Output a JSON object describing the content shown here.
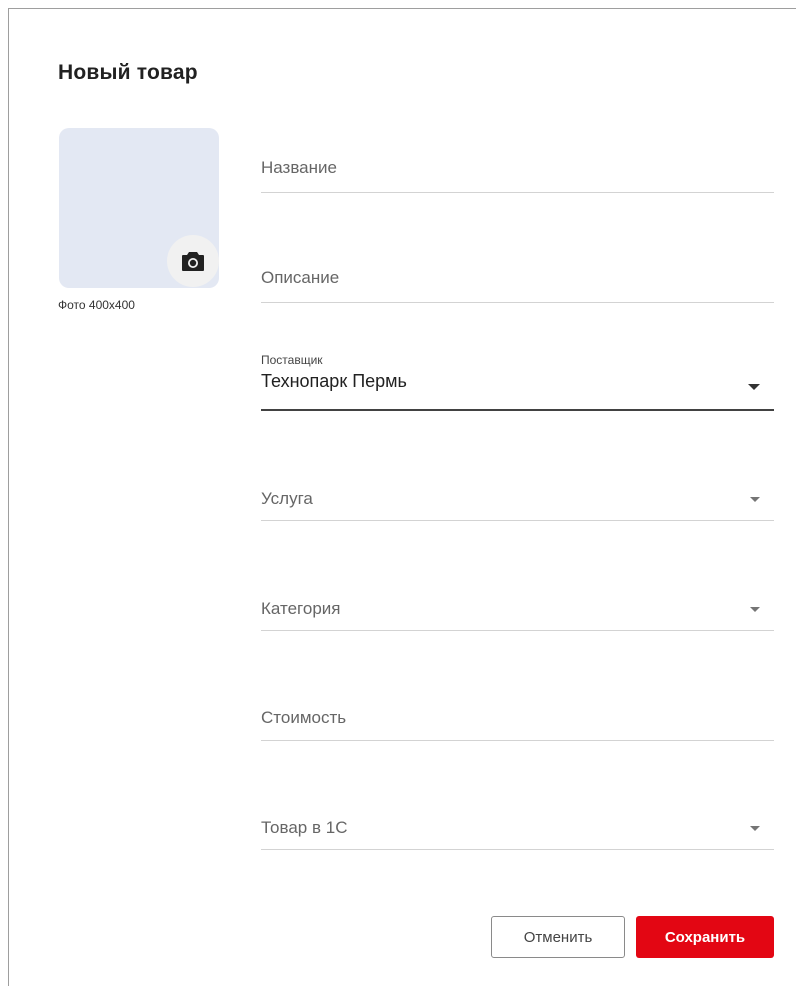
{
  "dialog": {
    "title": "Новый товар"
  },
  "photo": {
    "caption": "Фото 400x400",
    "icon": "camera-icon",
    "placeholder_color": "#e3e8f3"
  },
  "fields": {
    "name": {
      "placeholder": "Название"
    },
    "description": {
      "placeholder": "Описание"
    },
    "supplier": {
      "label": "Поставщик",
      "value": "Технопарк Пермь"
    },
    "service": {
      "placeholder": "Услуга"
    },
    "category": {
      "placeholder": "Категория"
    },
    "price": {
      "placeholder": "Стоимость"
    },
    "product_1c": {
      "placeholder": "Товар в 1С"
    }
  },
  "actions": {
    "cancel_label": "Отменить",
    "save_label": "Сохранить",
    "accent_color": "#e30613"
  }
}
